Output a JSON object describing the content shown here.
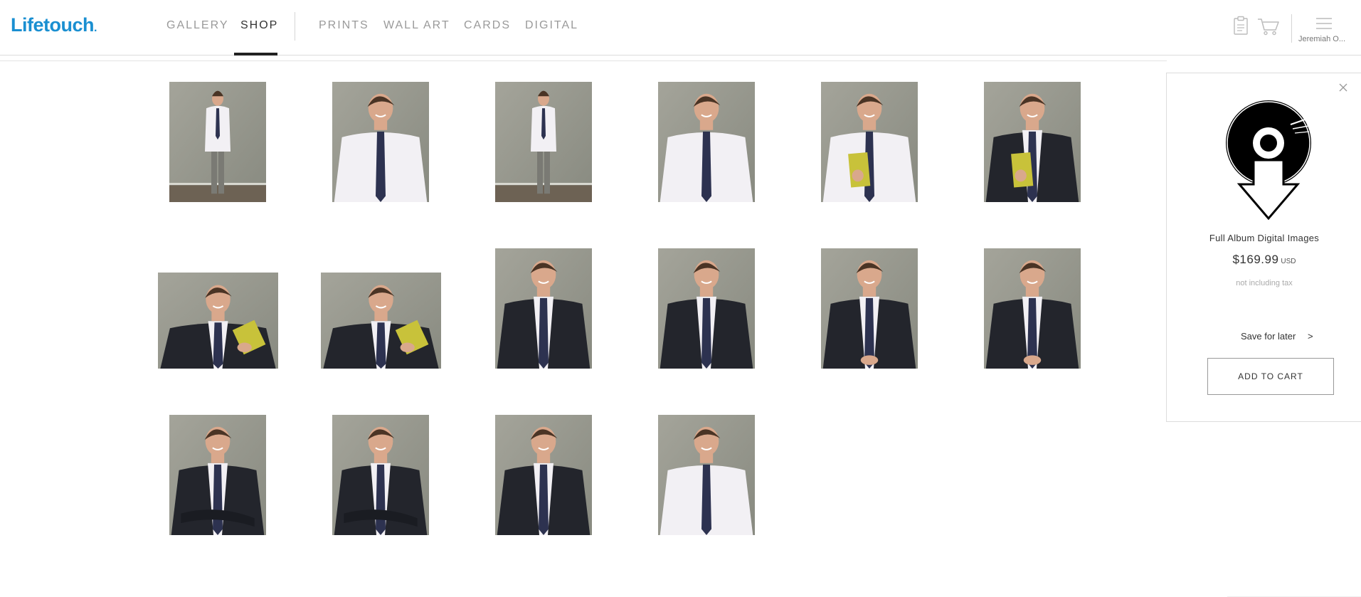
{
  "brand": {
    "name": "Lifetouch",
    "accent": "#1a8fd1"
  },
  "nav": {
    "primary": [
      {
        "label": "GALLERY",
        "active": false
      },
      {
        "label": "SHOP",
        "active": true
      }
    ],
    "shop_categories": [
      {
        "label": "PRINTS"
      },
      {
        "label": "WALL ART"
      },
      {
        "label": "CARDS"
      },
      {
        "label": "DIGITAL"
      }
    ]
  },
  "header_icons": [
    "clipboard-icon",
    "cart-icon",
    "menu-icon"
  ],
  "user": {
    "name": "Jeremiah O..."
  },
  "gallery": {
    "photos": [
      {
        "pose": "full-length-suit"
      },
      {
        "pose": "headshot-white-shirt"
      },
      {
        "pose": "full-length-white-shirt"
      },
      {
        "pose": "headshot-white-shirt"
      },
      {
        "pose": "white-shirt-holding-book"
      },
      {
        "pose": "suit-holding-book"
      },
      {
        "pose": "suit-reading-book"
      },
      {
        "pose": "suit-reading-book"
      },
      {
        "pose": "suit-portrait"
      },
      {
        "pose": "suit-portrait"
      },
      {
        "pose": "suit-hands-clasped"
      },
      {
        "pose": "suit-hands-clasped"
      },
      {
        "pose": "suit-arms-crossed"
      },
      {
        "pose": "suit-arms-crossed"
      },
      {
        "pose": "suit-portrait"
      },
      {
        "pose": "white-shirt-seated"
      }
    ]
  },
  "panel": {
    "icon": "digital-download-icon",
    "product_name": "Full Album Digital Images",
    "price": "$169.99",
    "currency": "USD",
    "tax_note": "not including tax",
    "save_label": "Save for later",
    "save_chevron": ">",
    "add_to_cart_label": "ADD TO CART"
  }
}
